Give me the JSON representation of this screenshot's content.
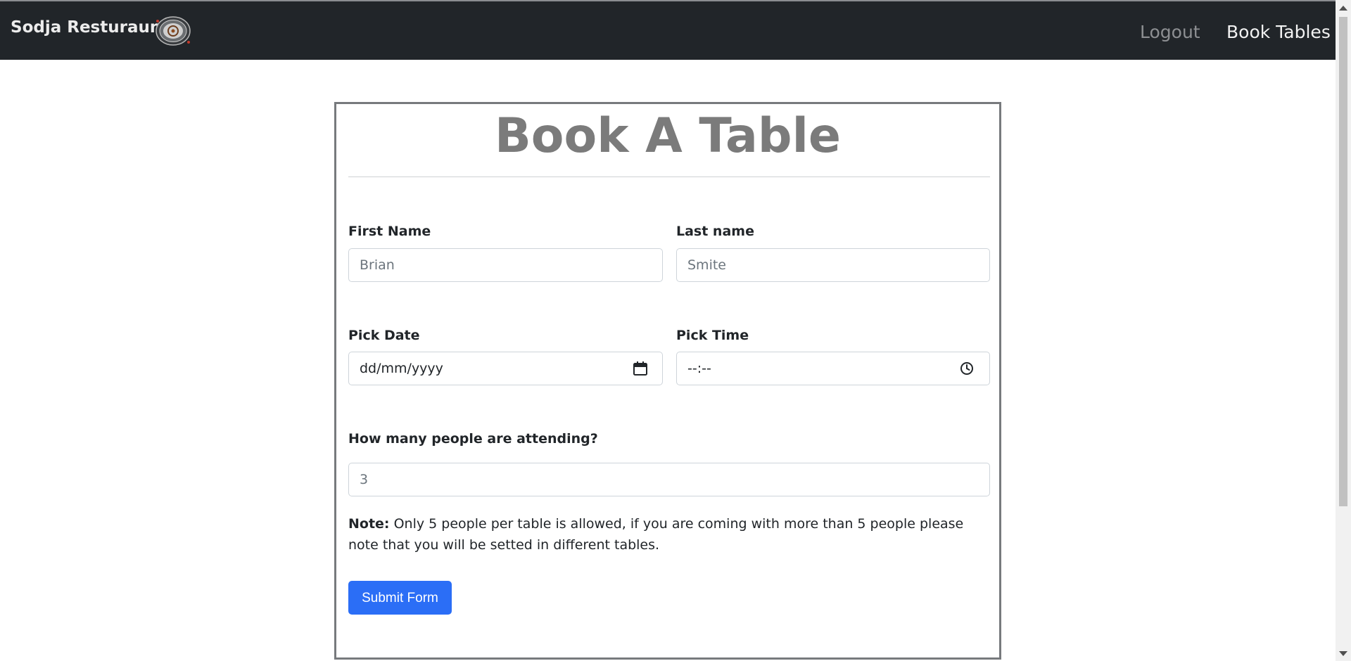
{
  "navbar": {
    "brand": "Sodja Resturaunt",
    "links": [
      {
        "label": "Logout"
      },
      {
        "label": "Book Tables"
      }
    ]
  },
  "form": {
    "title": "Book A Table",
    "first_name": {
      "label": "First Name",
      "placeholder": "Brian"
    },
    "last_name": {
      "label": "Last name",
      "placeholder": "Smite"
    },
    "date": {
      "label": "Pick Date",
      "placeholder": "dd/mm/yyyy"
    },
    "time": {
      "label": "Pick Time",
      "placeholder": "--:--"
    },
    "people": {
      "label": "How many people are attending?",
      "placeholder": "3"
    },
    "note": {
      "bold": "Note:",
      "text": " Only 5 people per table is allowed, if you are coming with more than 5 people please note that you will be setted in different tables."
    },
    "submit_label": "Submit Form"
  },
  "colors": {
    "navbar_bg": "#212529",
    "title": "#7b7b7b",
    "submit_bg": "#2b6ef6"
  },
  "icons": [
    "logo-icon",
    "calendar-icon",
    "clock-icon"
  ]
}
